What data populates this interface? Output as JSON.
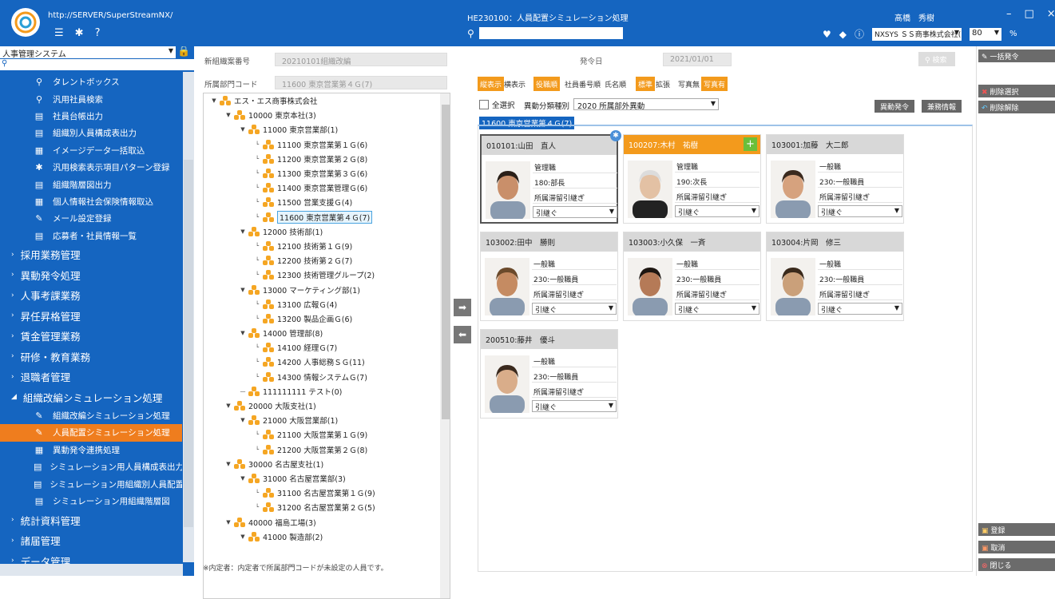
{
  "topbar": {
    "url": "http://SERVER/SuperStreamNX/",
    "title": "HE230100：人員配置シミュレーション処理",
    "user": "髙橋　秀樹",
    "company": "NXSYS ＳＳ商事株式会社(",
    "zoom": "80",
    "zoom_unit": "%"
  },
  "sidebar": {
    "system": "人事管理システム",
    "items": [
      {
        "label": "タレントボックス",
        "icon": "search-icon",
        "level": "sub"
      },
      {
        "label": "汎用社員検索",
        "icon": "search-icon",
        "level": "sub"
      },
      {
        "label": "社員台帳出力",
        "icon": "document-icon",
        "level": "sub"
      },
      {
        "label": "組織別人員構成表出力",
        "icon": "document-icon",
        "level": "sub"
      },
      {
        "label": "イメージデータ一括取込",
        "icon": "import-icon",
        "level": "sub"
      },
      {
        "label": "汎用検索表示項目パターン登録",
        "icon": "gear-icon",
        "level": "sub"
      },
      {
        "label": "組織階層図出力",
        "icon": "document-icon",
        "level": "sub"
      },
      {
        "label": "個人情報社会保険情報取込",
        "icon": "import-icon",
        "level": "sub"
      },
      {
        "label": "メール設定登録",
        "icon": "tool-icon",
        "level": "sub"
      },
      {
        "label": "応募者・社員情報一覧",
        "icon": "document-icon",
        "level": "sub"
      },
      {
        "label": "採用業務管理",
        "level": "top"
      },
      {
        "label": "異動発令処理",
        "level": "top"
      },
      {
        "label": "人事考課業務",
        "level": "top"
      },
      {
        "label": "昇任昇格管理",
        "level": "top"
      },
      {
        "label": "賃金管理業務",
        "level": "top"
      },
      {
        "label": "研修・教育業務",
        "level": "top"
      },
      {
        "label": "退職者管理",
        "level": "top"
      },
      {
        "label": "組織改編シミュレーション処理",
        "level": "top",
        "open": true
      },
      {
        "label": "組織改編シミュレーション処理",
        "icon": "tool-icon",
        "level": "sub"
      },
      {
        "label": "人員配置シミュレーション処理",
        "icon": "tool-icon",
        "level": "sub",
        "active": true
      },
      {
        "label": "異動発令連携処理",
        "icon": "import-icon",
        "level": "sub"
      },
      {
        "label": "シミュレーション用人員構成表出力",
        "icon": "document-icon",
        "level": "sub"
      },
      {
        "label": "シミュレーション用組織別人員配置",
        "icon": "document-icon",
        "level": "sub"
      },
      {
        "label": "シミュレーション用組織階層図",
        "icon": "document-icon",
        "level": "sub"
      },
      {
        "label": "統計資料管理",
        "level": "top"
      },
      {
        "label": "諸届管理",
        "level": "top"
      },
      {
        "label": "データ管理",
        "level": "top"
      }
    ]
  },
  "mid": {
    "org_no_label": "新組織案番号",
    "org_no_value": "20210101組織改編",
    "dept_label": "所属部門コード",
    "dept_value": "11600 東京営業第４Ｇ(7)",
    "note": "※内定者：内定者で所属部門コードが未設定の人員です。",
    "tree": [
      {
        "indent": 0,
        "tw": "▼",
        "label": "エス・エス商事株式会社"
      },
      {
        "indent": 1,
        "tw": "▼",
        "label": "10000 東京本社(3)"
      },
      {
        "indent": 2,
        "tw": "▼",
        "label": "11000 東京営業部(1)"
      },
      {
        "indent": 3,
        "tw": "",
        "label": "11100 東京営業第１Ｇ(6)"
      },
      {
        "indent": 3,
        "tw": "",
        "label": "11200 東京営業第２Ｇ(8)"
      },
      {
        "indent": 3,
        "tw": "",
        "label": "11300 東京営業第３Ｇ(6)"
      },
      {
        "indent": 3,
        "tw": "",
        "label": "11400 東京営業管理Ｇ(6)"
      },
      {
        "indent": 3,
        "tw": "",
        "label": "11500 営業支援Ｇ(4)"
      },
      {
        "indent": 3,
        "tw": "",
        "label": "11600 東京営業第４Ｇ(7)",
        "sel": true
      },
      {
        "indent": 2,
        "tw": "▼",
        "label": "12000 技術部(1)"
      },
      {
        "indent": 3,
        "tw": "",
        "label": "12100 技術第１Ｇ(9)"
      },
      {
        "indent": 3,
        "tw": "",
        "label": "12200 技術第２Ｇ(7)"
      },
      {
        "indent": 3,
        "tw": "",
        "label": "12300 技術管理グループ(2)"
      },
      {
        "indent": 2,
        "tw": "▼",
        "label": "13000 マーケティング部(1)"
      },
      {
        "indent": 3,
        "tw": "",
        "label": "13100 広報Ｇ(4)"
      },
      {
        "indent": 3,
        "tw": "",
        "label": "13200 製品企画Ｇ(6)"
      },
      {
        "indent": 2,
        "tw": "▼",
        "label": "14000 管理部(8)"
      },
      {
        "indent": 3,
        "tw": "",
        "label": "14100 経理Ｇ(7)"
      },
      {
        "indent": 3,
        "tw": "",
        "label": "14200 人事総務ＳＧ(11)"
      },
      {
        "indent": 3,
        "tw": "",
        "label": "14300 情報システムＧ(7)"
      },
      {
        "indent": 2,
        "tw": "—",
        "label": "111111111 テスト(0)"
      },
      {
        "indent": 1,
        "tw": "▼",
        "label": "20000 大阪支社(1)"
      },
      {
        "indent": 2,
        "tw": "▼",
        "label": "21000 大阪営業部(1)"
      },
      {
        "indent": 3,
        "tw": "",
        "label": "21100 大阪営業第１Ｇ(9)"
      },
      {
        "indent": 3,
        "tw": "",
        "label": "21200 大阪営業第２Ｇ(8)"
      },
      {
        "indent": 1,
        "tw": "▼",
        "label": "30000 名古屋支社(1)"
      },
      {
        "indent": 2,
        "tw": "▼",
        "label": "31000 名古屋営業部(3)"
      },
      {
        "indent": 3,
        "tw": "",
        "label": "31100 名古屋営業第１Ｇ(9)"
      },
      {
        "indent": 3,
        "tw": "",
        "label": "31200 名古屋営業第２Ｇ(5)"
      },
      {
        "indent": 1,
        "tw": "▼",
        "label": "40000 福島工場(3)"
      },
      {
        "indent": 2,
        "tw": "▼",
        "label": "41000 製造部(2)"
      }
    ]
  },
  "right": {
    "date_label": "発令日",
    "date_value": "2021/01/01",
    "search_btn": "検索",
    "toggles": [
      {
        "label": "縦表示",
        "on": true
      },
      {
        "label": "横表示",
        "on": false
      },
      {
        "label": "役職順",
        "on": true
      },
      {
        "label": "社員番号順",
        "on": false
      },
      {
        "label": "氏名順",
        "on": false
      },
      {
        "label": "標準",
        "on": true
      },
      {
        "label": "拡張",
        "on": false
      },
      {
        "label": "写真無",
        "on": false
      },
      {
        "label": "写真有",
        "on": true
      }
    ],
    "select_all": "全選択",
    "category_label": "異動分類種別",
    "category_value": "2020 所属部外異動",
    "btn_order": "異動発令",
    "btn_concurrent": "兼務情報",
    "dept_tag": "11600 東京営業第４Ｇ(7)",
    "cards": [
      {
        "name": "010101:山田　直人",
        "f1": "管理職",
        "f2": "180:部長",
        "f3": "所属滞留引継ぎ",
        "dd": "引継ぐ",
        "style": "sel"
      },
      {
        "name": "100207:木村　祐樹",
        "f1": "管理職",
        "f2": "190:次長",
        "f3": "所属滞留引継ぎ",
        "dd": "引継ぐ",
        "style": "orange"
      },
      {
        "name": "103001:加藤　大二郎",
        "f1": "一般職",
        "f2": "230:一般職員",
        "f3": "所属滞留引継ぎ",
        "dd": "引継ぐ",
        "style": ""
      },
      {
        "name": "103002:田中　勝則",
        "f1": "一般職",
        "f2": "230:一般職員",
        "f3": "所属滞留引継ぎ",
        "dd": "引継ぐ",
        "style": ""
      },
      {
        "name": "103003:小久保　一斉",
        "f1": "一般職",
        "f2": "230:一般職員",
        "f3": "所属滞留引継ぎ",
        "dd": "引継ぐ",
        "style": ""
      },
      {
        "name": "103004:片岡　修三",
        "f1": "一般職",
        "f2": "230:一般職員",
        "f3": "所属滞留引継ぎ",
        "dd": "引継ぐ",
        "style": ""
      },
      {
        "name": "200510:藤井　優斗",
        "f1": "一般職",
        "f2": "230:一般職員",
        "f3": "所属滞留引継ぎ",
        "dd": "引継ぐ",
        "style": ""
      }
    ]
  },
  "right_panel": {
    "bulk": "一括発令",
    "del_select": "削除選択",
    "del_cancel": "削除解除",
    "register": "登録",
    "cancel": "取消",
    "close": "閉じる"
  }
}
